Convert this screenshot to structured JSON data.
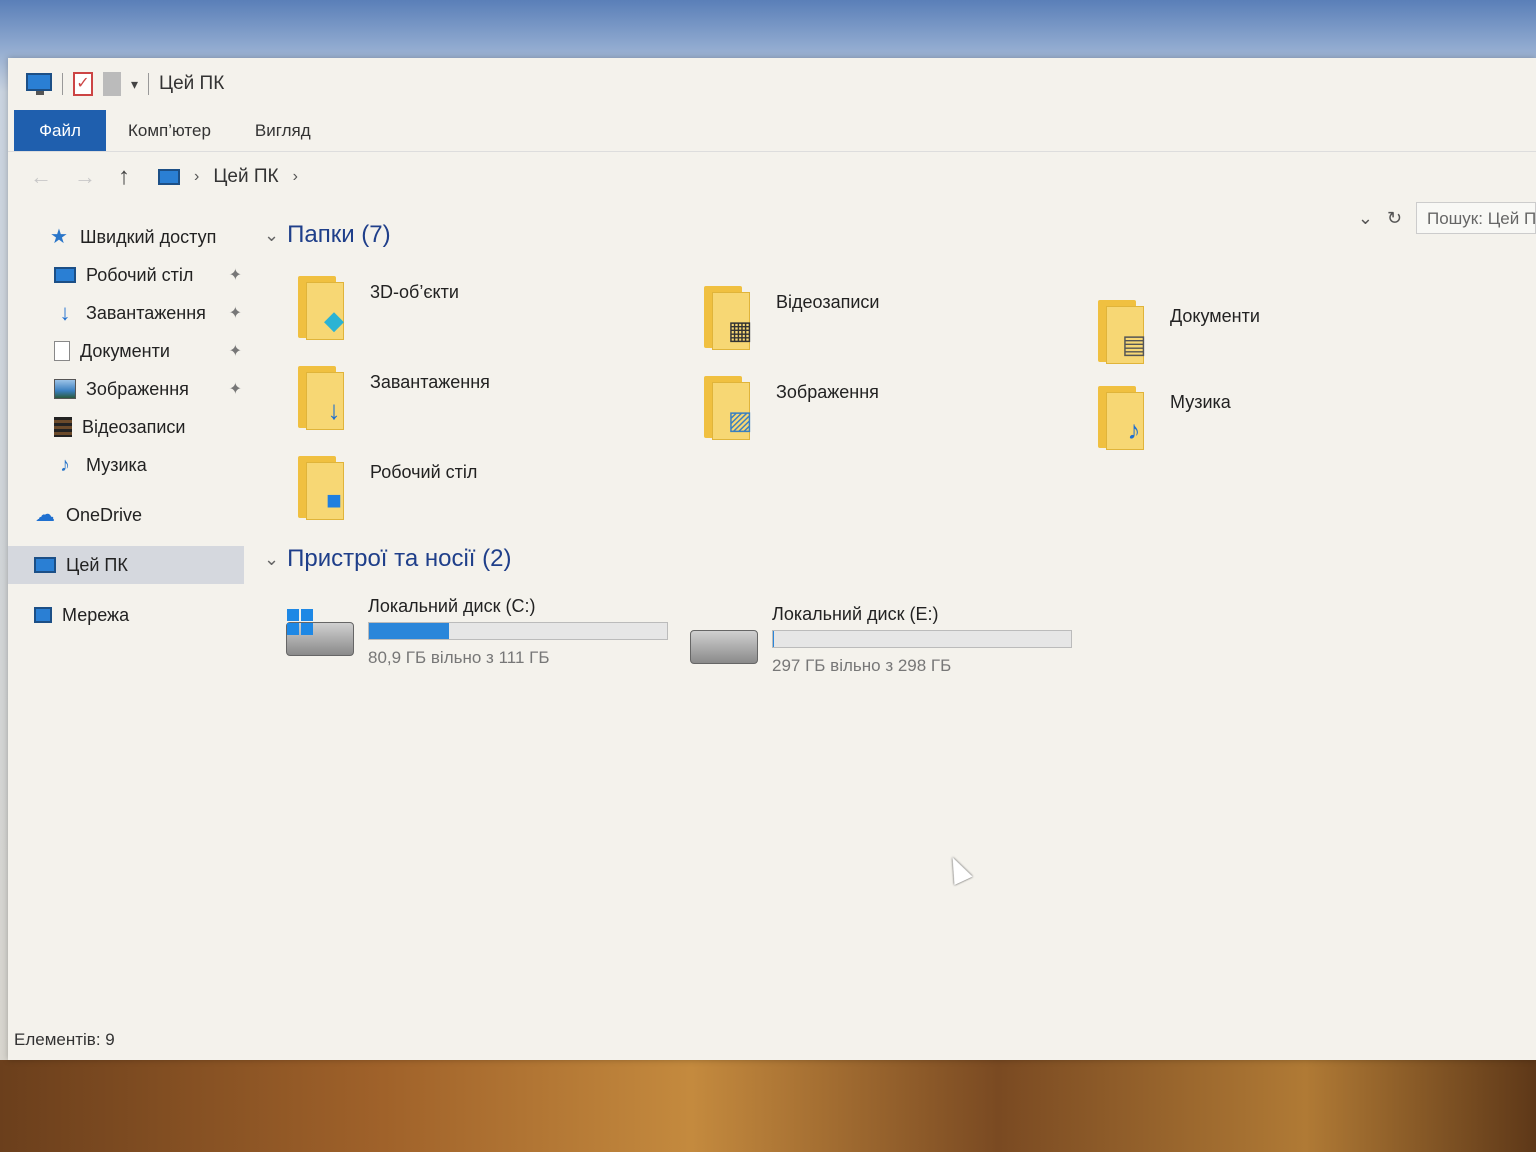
{
  "window": {
    "title": "Цей ПК",
    "quick_access_arrow": "▾"
  },
  "ribbon": {
    "tabs": [
      "Файл",
      "Комп’ютер",
      "Вигляд"
    ]
  },
  "address": {
    "back": "←",
    "forward": "→",
    "up": "↑",
    "path_label": "Цей ПК",
    "sep1": "›",
    "sep2": "›"
  },
  "search": {
    "dropdown": "⌄",
    "refresh": "↻",
    "placeholder": "Пошук: Цей ПК"
  },
  "sidebar": {
    "quick_access": "Швидкий доступ",
    "items": [
      {
        "label": "Робочий стіл",
        "icon": "desktop-icon",
        "pinned": true
      },
      {
        "label": "Завантаження",
        "icon": "download-icon",
        "pinned": true
      },
      {
        "label": "Документи",
        "icon": "documents-icon",
        "pinned": true
      },
      {
        "label": "Зображення",
        "icon": "pictures-icon",
        "pinned": true
      },
      {
        "label": "Відеозаписи",
        "icon": "videos-icon",
        "pinned": false
      },
      {
        "label": "Музика",
        "icon": "music-icon",
        "pinned": false
      }
    ],
    "onedrive": "OneDrive",
    "this_pc": "Цей ПК",
    "network": "Мережа",
    "pin_glyph": "📌"
  },
  "folders_section": {
    "title": "Папки (7)",
    "chevron": "⌄",
    "folders": [
      {
        "name": "3D-об’єкти",
        "icon": "3d-objects-icon"
      },
      {
        "name": "Відеозаписи",
        "icon": "videos-folder-icon"
      },
      {
        "name": "Документи",
        "icon": "documents-folder-icon"
      },
      {
        "name": "Завантаження",
        "icon": "downloads-folder-icon"
      },
      {
        "name": "Зображення",
        "icon": "pictures-folder-icon"
      },
      {
        "name": "Музика",
        "icon": "music-folder-icon"
      },
      {
        "name": "Робочий стіл",
        "icon": "desktop-folder-icon"
      }
    ]
  },
  "drives_section": {
    "title": "Пристрої та носії (2)",
    "chevron": "⌄",
    "drives": [
      {
        "name": "Локальний диск (C:)",
        "free_text": "80,9 ГБ вільно з 111 ГБ",
        "used_fraction": 0.27,
        "system": true
      },
      {
        "name": "Локальний диск (E:)",
        "free_text": "297 ГБ вільно з 298 ГБ",
        "used_fraction": 0.003,
        "system": false
      }
    ]
  },
  "status": {
    "items_count": "Елементів: 9"
  },
  "colors": {
    "accent": "#1f5fae",
    "drive_bar": "#2a86da",
    "folder": "#f7d774"
  }
}
